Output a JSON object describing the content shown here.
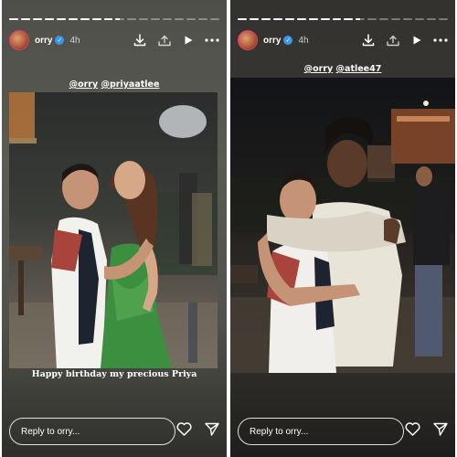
{
  "stories": [
    {
      "username": "orry",
      "time": "4h",
      "mentions": [
        "@orry",
        "@priyaatlee"
      ],
      "caption": "Happy birthday my precious Priya",
      "reply_placeholder": "Reply to orry...",
      "progress": [
        1,
        1,
        1,
        1,
        1,
        1,
        1,
        1,
        1,
        0.5,
        0,
        0,
        0,
        0,
        0,
        0,
        0,
        0
      ]
    },
    {
      "username": "orry",
      "time": "4h",
      "mentions": [
        "@orry",
        "@atlee47"
      ],
      "caption": "",
      "reply_placeholder": "Reply to orry...",
      "progress": [
        1,
        1,
        1,
        1,
        1,
        1,
        1,
        1,
        1,
        1,
        0.5,
        0,
        0,
        0,
        0,
        0,
        0,
        0
      ]
    }
  ],
  "icons": [
    "download-icon",
    "collab-icon",
    "play-icon",
    "more-icon",
    "heart-icon",
    "send-icon"
  ],
  "colors": {
    "verified": "#3897f0",
    "avatar_ring": "#e43d6f"
  }
}
